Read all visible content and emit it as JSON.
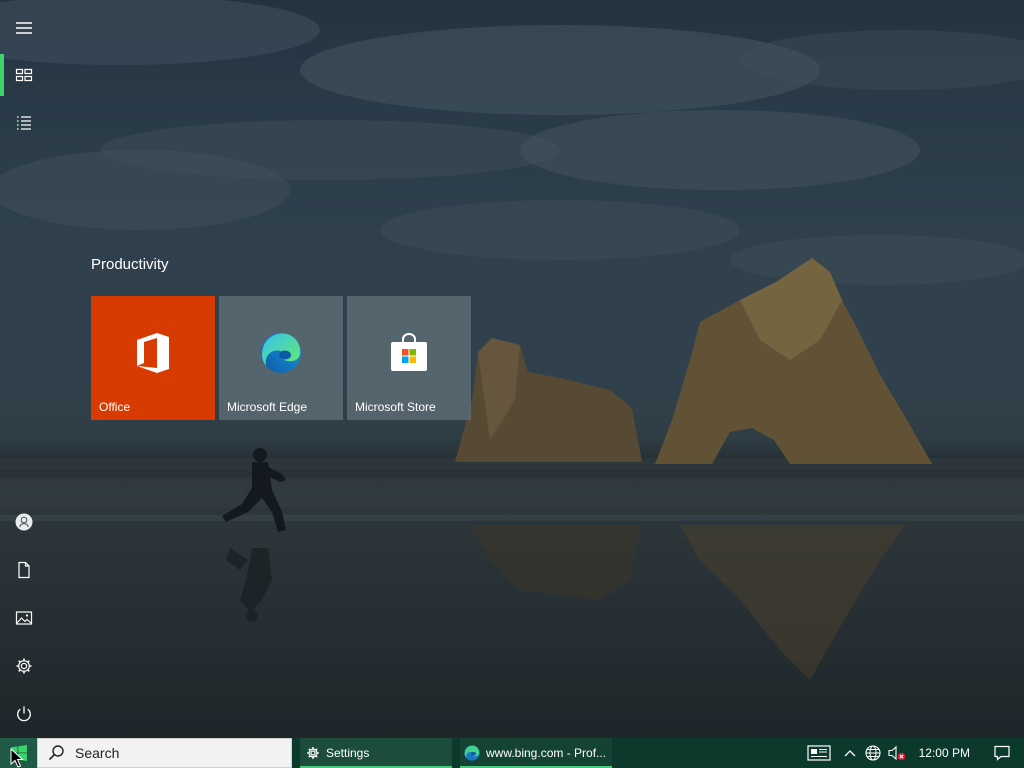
{
  "start_rail": {
    "top_items": [
      {
        "icon": "hamburger-menu-icon",
        "label": "Expand"
      },
      {
        "icon": "pinned-tiles-icon",
        "label": "Pinned tiles"
      },
      {
        "icon": "all-apps-icon",
        "label": "All apps"
      }
    ],
    "bottom_items": [
      {
        "icon": "user-account-icon",
        "label": "Account"
      },
      {
        "icon": "documents-icon",
        "label": "Documents"
      },
      {
        "icon": "pictures-icon",
        "label": "Pictures"
      },
      {
        "icon": "settings-gear-icon",
        "label": "Settings"
      },
      {
        "icon": "power-icon",
        "label": "Power"
      }
    ]
  },
  "tile_group": {
    "title": "Productivity",
    "tiles": [
      {
        "label": "Office",
        "icon": "office-logo-icon",
        "color": "#d83b01"
      },
      {
        "label": "Microsoft Edge",
        "icon": "edge-logo-icon",
        "color": "#5f6e76"
      },
      {
        "label": "Microsoft Store",
        "icon": "store-bag-icon",
        "color": "#5f6e76"
      }
    ]
  },
  "taskbar": {
    "search_placeholder": "Search",
    "apps": [
      {
        "label": "Settings",
        "icon": "settings-gear-icon"
      },
      {
        "label": "www.bing.com - Prof...",
        "icon": "edge-logo-icon"
      }
    ],
    "tray": {
      "icons": [
        "news-icon",
        "chevron-up-icon",
        "network-globe-icon",
        "volume-muted-icon",
        "notifications-icon"
      ],
      "time": "12:00 PM"
    }
  },
  "colors": {
    "accent": "#3ad36c",
    "taskbar": "#0b3a2c",
    "office_tile": "#d83b01"
  }
}
